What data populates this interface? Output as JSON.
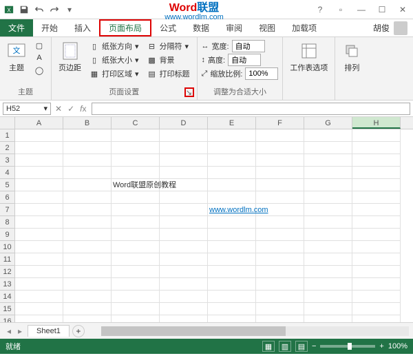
{
  "titlebar": {
    "title_word": "Word",
    "title_union": "联盟",
    "subtitle": "www.wordlm.com"
  },
  "tabs": {
    "file": "文件",
    "items": [
      "开始",
      "插入",
      "页面布局",
      "公式",
      "数据",
      "审阅",
      "视图",
      "加载项"
    ],
    "active_index": 2,
    "user": "胡俊"
  },
  "ribbon": {
    "theme": {
      "label": "主题",
      "btn": "主题"
    },
    "margins": {
      "btn": "页边距"
    },
    "page_setup": {
      "label": "页面设置",
      "orientation": "纸张方向",
      "size": "纸张大小",
      "print_area": "打印区域",
      "breaks": "分隔符",
      "background": "背景",
      "print_titles": "打印标题"
    },
    "scale": {
      "label": "调整为合适大小",
      "width": "宽度:",
      "height": "高度:",
      "scale": "缩放比例:",
      "auto": "自动",
      "pct": "100%"
    },
    "sheet_opts": {
      "btn": "工作表选项"
    },
    "arrange": {
      "btn": "排列"
    }
  },
  "namebox": {
    "ref": "H52"
  },
  "grid": {
    "cols": [
      "A",
      "B",
      "C",
      "D",
      "E",
      "F",
      "G",
      "H"
    ],
    "active_col": "H",
    "rows": 16,
    "cells": {
      "C5": "Word联盟原创教程",
      "E7": "www.wordlm.com"
    }
  },
  "sheets": {
    "active": "Sheet1"
  },
  "status": {
    "ready": "就绪",
    "zoom": "100%"
  }
}
